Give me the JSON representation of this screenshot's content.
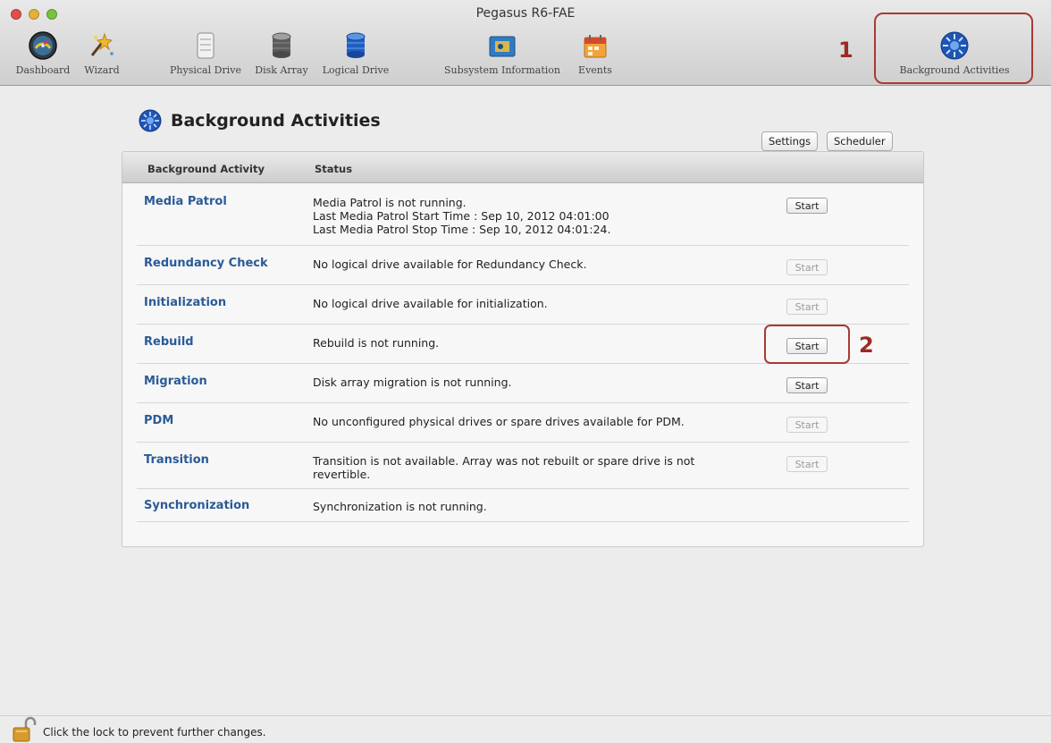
{
  "window": {
    "title": "Pegasus R6-FAE"
  },
  "toolbar": {
    "items": [
      {
        "label": "Dashboard",
        "icon": "dashboard-icon"
      },
      {
        "label": "Wizard",
        "icon": "wizard-icon"
      },
      {
        "label": "Physical Drive",
        "icon": "physical-drive-icon"
      },
      {
        "label": "Disk Array",
        "icon": "disk-array-icon"
      },
      {
        "label": "Logical Drive",
        "icon": "logical-drive-icon"
      },
      {
        "label": "Subsystem Information",
        "icon": "subsystem-information-icon"
      },
      {
        "label": "Events",
        "icon": "events-icon"
      },
      {
        "label": "Background Activities",
        "icon": "background-activities-icon"
      }
    ],
    "active": "Background Activities"
  },
  "annotations": {
    "one": "1",
    "two": "2"
  },
  "page": {
    "title": "Background Activities",
    "settings_label": "Settings",
    "scheduler_label": "Scheduler"
  },
  "table": {
    "columns": [
      "Background Activity",
      "Status"
    ],
    "rows": [
      {
        "name": "Media Patrol",
        "status": [
          "Media Patrol is not running.",
          "Last Media Patrol Start Time : Sep 10, 2012 04:01:00",
          "Last Media Patrol Stop Time : Sep 10, 2012 04:01:24."
        ],
        "button": "Start",
        "enabled": true
      },
      {
        "name": "Redundancy Check",
        "status": [
          "No logical drive available for Redundancy Check."
        ],
        "button": "Start",
        "enabled": false
      },
      {
        "name": "Initialization",
        "status": [
          "No logical drive available for initialization."
        ],
        "button": "Start",
        "enabled": false
      },
      {
        "name": "Rebuild",
        "status": [
          "Rebuild is not running."
        ],
        "button": "Start",
        "enabled": true
      },
      {
        "name": "Migration",
        "status": [
          "Disk array migration is not running."
        ],
        "button": "Start",
        "enabled": true
      },
      {
        "name": "PDM",
        "status": [
          "No unconfigured physical drives or spare drives available for PDM."
        ],
        "button": "Start",
        "enabled": false
      },
      {
        "name": "Transition",
        "status": [
          "Transition is not available. Array was not rebuilt or spare drive is not",
          "revertible."
        ],
        "button": "Start",
        "enabled": false
      },
      {
        "name": "Synchronization",
        "status": [
          "Synchronization is not running."
        ],
        "button": "",
        "enabled": false
      }
    ]
  },
  "footer": {
    "lock_text": "Click the lock to prevent further changes."
  },
  "colors": {
    "link": "#2a5a97",
    "annotation": "#9c2a23",
    "accent": "#1f5fbf"
  }
}
